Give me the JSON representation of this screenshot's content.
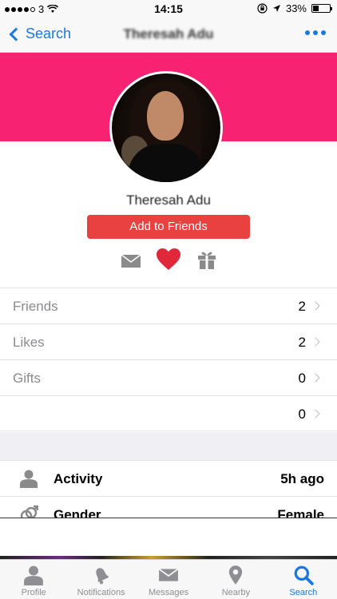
{
  "status_bar": {
    "carrier": "3",
    "time": "14:15",
    "battery": "33%",
    "battery_level": 0.33
  },
  "nav": {
    "back_label": "Search",
    "title": "Theresah Adu"
  },
  "profile": {
    "name": "Theresah Adu",
    "add_button": "Add to Friends"
  },
  "stats": [
    {
      "label": "Friends",
      "value": "2"
    },
    {
      "label": "Likes",
      "value": "2"
    },
    {
      "label": "Gifts",
      "value": "0"
    },
    {
      "label": "",
      "value": "0"
    }
  ],
  "details": [
    {
      "label": "Activity",
      "value": "5h ago",
      "icon": "person-icon"
    },
    {
      "label": "Gender",
      "value": "Female",
      "icon": "gender-icon"
    }
  ],
  "tabs": [
    {
      "label": "Profile",
      "icon": "person-icon"
    },
    {
      "label": "Notifications",
      "icon": "bell-icon"
    },
    {
      "label": "Messages",
      "icon": "envelope-icon"
    },
    {
      "label": "Nearby",
      "icon": "location-pin-icon"
    },
    {
      "label": "Search",
      "icon": "search-icon",
      "active": true
    }
  ],
  "colors": {
    "accent": "#1a78e0",
    "cover": "#f72372",
    "add_button": "#e94040",
    "heart": "#e0283a"
  }
}
